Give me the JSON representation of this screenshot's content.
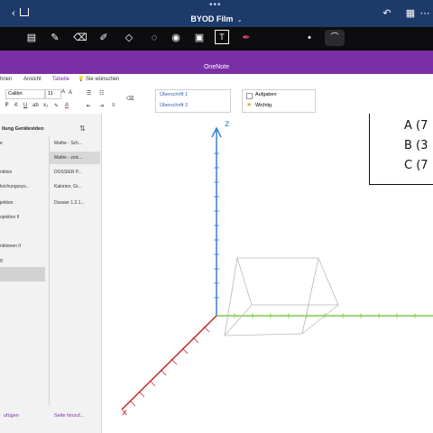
{
  "ipad": {
    "dots": "•••",
    "title": "BYOD Film",
    "toolbar_icons": [
      "sidebar-icon",
      "pen-icon",
      "eraser-icon",
      "highlighter-icon",
      "shapes-icon",
      "lasso-icon",
      "eye-icon",
      "image-icon",
      "text-icon",
      "bluetooth-pen-icon",
      "dot-icon",
      "stroke-icon"
    ]
  },
  "onenote": {
    "title": "OneNote",
    "tabs": [
      "hnen",
      "Ansicht",
      "Tabelle"
    ],
    "tell_me": "Sie wünschen",
    "font": "Calibri",
    "font_size": "11",
    "styles": [
      "Überschrift 1",
      "Überschrift 2"
    ],
    "tags": [
      "Aufgaben",
      "Wichtig"
    ]
  },
  "sidebar": {
    "notebook": "llung Gerätevideo",
    "sections": [
      "e",
      "nktion",
      "leichungssys...",
      "jektion",
      "ojektion II",
      "nktionen II",
      "g",
      ""
    ],
    "pages": [
      "Mathe - Sch...",
      "Mathe - zeic...",
      "DOSSIER P...",
      "Kalorien, Gr...",
      "Dossier 1.2.1..."
    ],
    "add_section": "ufügen",
    "add_page": "Seite hinzuf..."
  },
  "canvas": {
    "z_label": "z",
    "x_label": "x",
    "points": [
      "A (7",
      "B (3",
      "C (7"
    ]
  }
}
